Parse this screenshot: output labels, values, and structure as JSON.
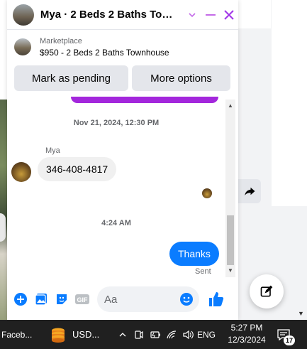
{
  "chat": {
    "title": "Mya · 2 Beds 2 Baths Town...",
    "listing": {
      "label": "Marketplace",
      "title": "$950 - 2 Beds 2 Baths Townhouse"
    },
    "actions": {
      "pending_label": "Mark as pending",
      "more_label": "More options"
    },
    "messages": {
      "timestamp1": "Nov 21, 2024, 12:30 PM",
      "sender_name": "Mya",
      "incoming_text": "346-408-4817",
      "timestamp2": "4:24 AM",
      "outgoing_text": "Thanks",
      "sent_status": "Sent"
    },
    "composer": {
      "placeholder": "Aa"
    }
  },
  "taskbar": {
    "app1_label": "Faceb...",
    "app2_label": "USD...",
    "language": "ENG",
    "time": "5:27 PM",
    "date": "12/3/2024",
    "notification_count": "17"
  },
  "colors": {
    "accent_purple": "#a327dc",
    "messenger_blue": "#0a7cff",
    "close_magenta": "#a033e8"
  }
}
